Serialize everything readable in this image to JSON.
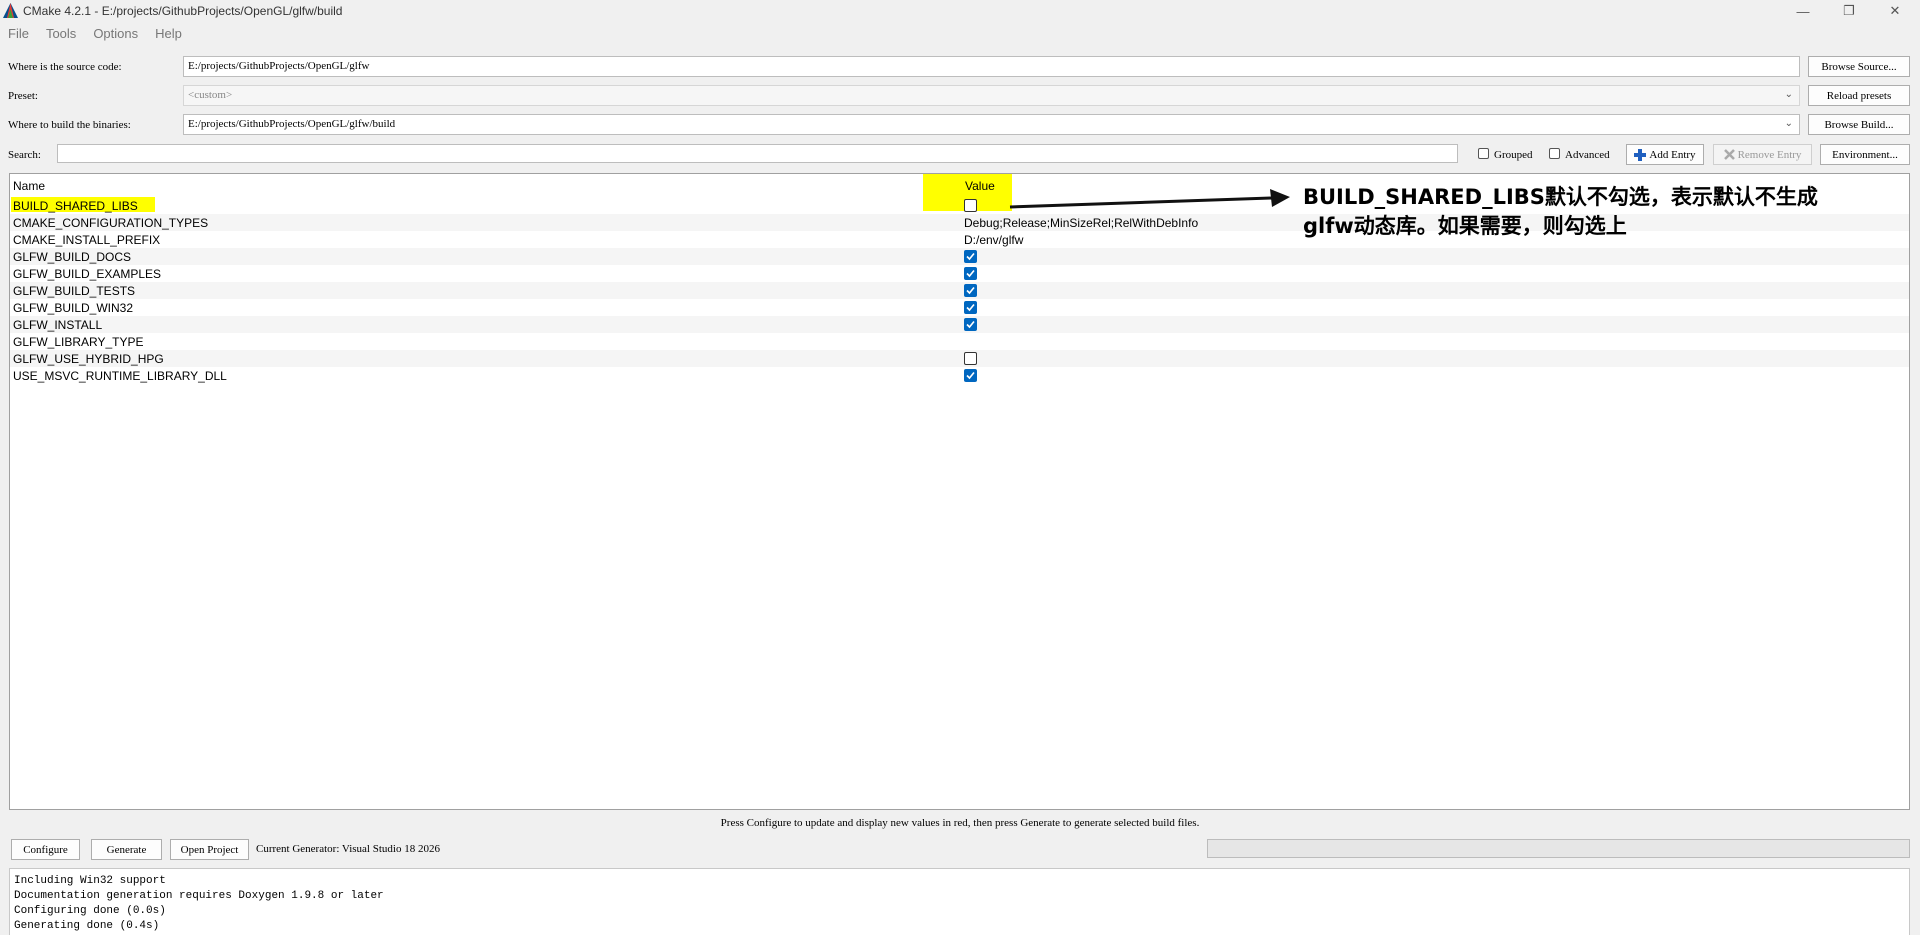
{
  "window": {
    "title": "CMake 4.2.1 - E:/projects/GithubProjects/OpenGL/glfw/build",
    "controls": [
      "—",
      "❐",
      "✕"
    ]
  },
  "menu": [
    "File",
    "Tools",
    "Options",
    "Help"
  ],
  "paths": {
    "source_label": "Where is the source code:",
    "source_value": "E:/projects/GithubProjects/OpenGL/glfw",
    "browse_source": "Browse Source...",
    "preset_label": "Preset:",
    "preset_value": "<custom>",
    "reload_presets": "Reload presets",
    "build_label": "Where to build the binaries:",
    "build_value": "E:/projects/GithubProjects/OpenGL/glfw/build",
    "browse_build": "Browse Build..."
  },
  "search": {
    "label": "Search:",
    "value": "",
    "grouped": "Grouped",
    "advanced": "Advanced",
    "add_entry": "Add Entry",
    "remove_entry": "Remove Entry",
    "environment": "Environment..."
  },
  "table": {
    "headers": [
      "Name",
      "Value"
    ],
    "rows": [
      {
        "name": "BUILD_SHARED_LIBS",
        "type": "bool",
        "value": false
      },
      {
        "name": "CMAKE_CONFIGURATION_TYPES",
        "type": "text",
        "value": "Debug;Release;MinSizeRel;RelWithDebInfo"
      },
      {
        "name": "CMAKE_INSTALL_PREFIX",
        "type": "text",
        "value": "D:/env/glfw"
      },
      {
        "name": "GLFW_BUILD_DOCS",
        "type": "bool",
        "value": true
      },
      {
        "name": "GLFW_BUILD_EXAMPLES",
        "type": "bool",
        "value": true
      },
      {
        "name": "GLFW_BUILD_TESTS",
        "type": "bool",
        "value": true
      },
      {
        "name": "GLFW_BUILD_WIN32",
        "type": "bool",
        "value": true
      },
      {
        "name": "GLFW_INSTALL",
        "type": "bool",
        "value": true
      },
      {
        "name": "GLFW_LIBRARY_TYPE",
        "type": "text",
        "value": ""
      },
      {
        "name": "GLFW_USE_HYBRID_HPG",
        "type": "bool",
        "value": false
      },
      {
        "name": "USE_MSVC_RUNTIME_LIBRARY_DLL",
        "type": "bool",
        "value": true
      }
    ]
  },
  "annotation": {
    "line1": "BUILD_SHARED_LIBS默认不勾选，表示默认不生成",
    "line2": "glfw动态库。如果需要，则勾选上"
  },
  "hint": "Press Configure to update and display new values in red, then press Generate to generate selected build files.",
  "actions": {
    "configure": "Configure",
    "generate": "Generate",
    "open_project": "Open Project",
    "generator": "Current Generator: Visual Studio 18 2026"
  },
  "output": [
    "Including Win32 support",
    "Documentation generation requires Doxygen 1.9.8 or later",
    "Configuring done (0.0s)",
    "Generating done (0.4s)"
  ],
  "colors": {
    "highlight": "#ffff00",
    "checkbox_checked": "#0067c0"
  }
}
